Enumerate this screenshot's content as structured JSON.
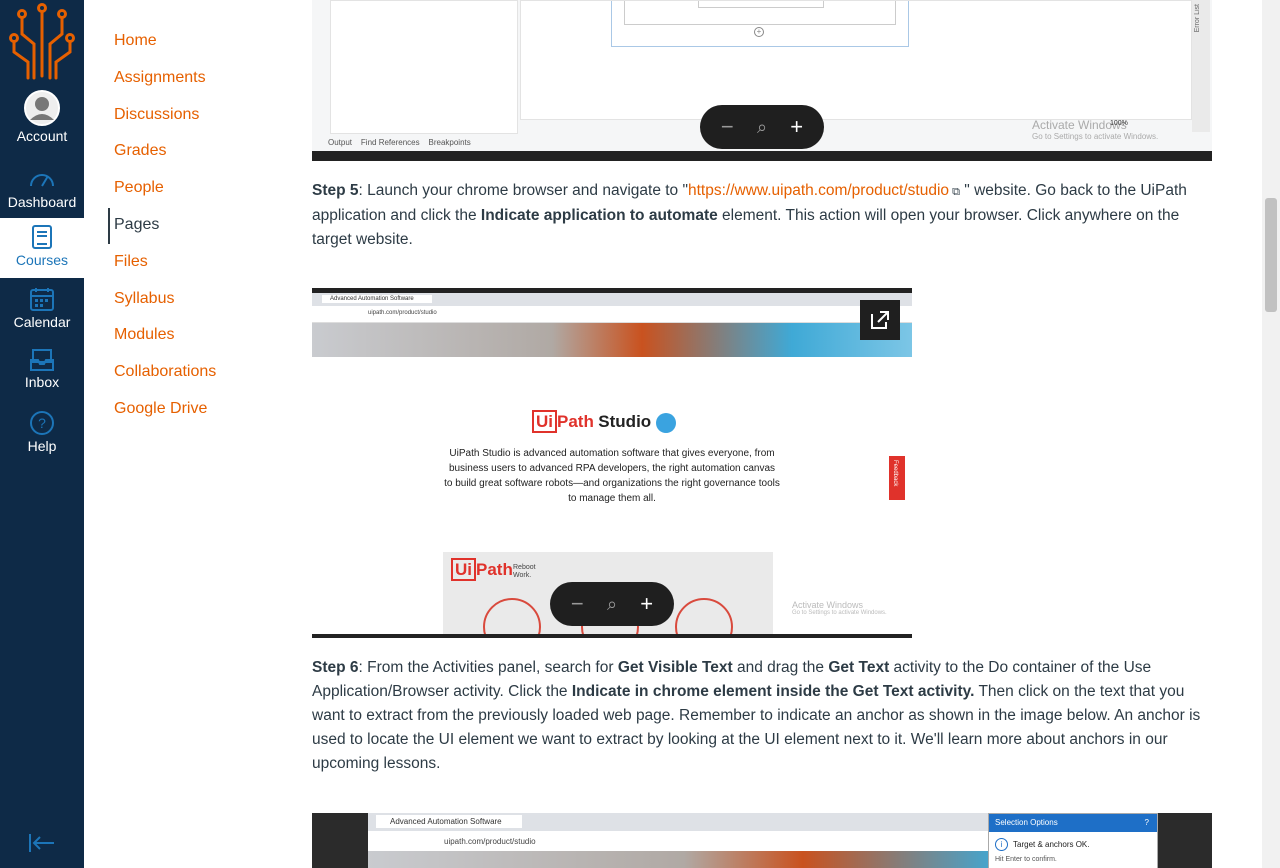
{
  "global_nav": {
    "items": [
      {
        "label": "Account",
        "icon": "avatar-icon"
      },
      {
        "label": "Dashboard",
        "icon": "dashboard-icon"
      },
      {
        "label": "Courses",
        "icon": "courses-icon"
      },
      {
        "label": "Calendar",
        "icon": "calendar-icon"
      },
      {
        "label": "Inbox",
        "icon": "inbox-icon"
      },
      {
        "label": "Help",
        "icon": "help-icon"
      }
    ],
    "active": "Courses",
    "colors": {
      "bg": "#0e2a47",
      "accent": "#1c75b8",
      "logo": "#e66000"
    }
  },
  "course_nav": {
    "items": [
      "Home",
      "Assignments",
      "Discussions",
      "Grades",
      "People",
      "Pages",
      "Files",
      "Syllabus",
      "Modules",
      "Collaborations",
      "Google Drive"
    ],
    "active": "Pages",
    "link_color": "#e66000"
  },
  "content": {
    "top_image": {
      "status_tabs": [
        "Output",
        "Find References",
        "Breakpoints"
      ],
      "zoom_level": "100%",
      "side_tab": "Error List",
      "watermark_title": "Activate Windows",
      "watermark_sub": "Go to Settings to activate Windows."
    },
    "step5": {
      "label": "Step 5",
      "t1": ": Launch your chrome browser and navigate to \"",
      "link": "https://www.uipath.com/product/studio",
      "t2": " \" website. Go back to the UiPath application and click the ",
      "bold": "Indicate application to automate",
      "t3": " element. This action will open your browser. Click anywhere on the target website."
    },
    "mid_image": {
      "tab_title": "Advanced Automation Software",
      "address": "uipath.com/product/studio",
      "brand_left": "Ui",
      "brand_right": "Path",
      "product": "Studio",
      "description": "UiPath Studio is advanced automation software that gives everyone, from business users to advanced RPA developers, the right automation canvas to build great software robots—and organizations the right governance tools to manage them all.",
      "reboot": "Reboot Work.",
      "feedback": "Feedback",
      "watermark_title": "Activate Windows",
      "watermark_sub": "Go to Settings to activate Windows."
    },
    "step6": {
      "label": "Step 6",
      "t1": ": From the Activities panel, search for ",
      "b1": "Get Visible Text",
      "t2": " and drag the ",
      "b2": "Get Text",
      "t3": " activity to the Do container of the Use Application/Browser activity. Click the ",
      "b3": "Indicate in chrome element inside the Get Text activity.",
      "t4": " Then click on the text that you want to extract from the previously loaded web page. Remember to indicate an anchor as shown in the image below. An anchor is used to locate the UI element we want to extract by looking at the UI element next to it. We'll learn more about anchors in our upcoming lessons."
    },
    "bottom_image": {
      "tab_title": "Advanced Automation Software",
      "address": "uipath.com/product/studio",
      "panel_title": "Selection Options",
      "panel_help": "?",
      "status": "Target & anchors OK.",
      "hint": "Hit Enter to confirm."
    }
  }
}
